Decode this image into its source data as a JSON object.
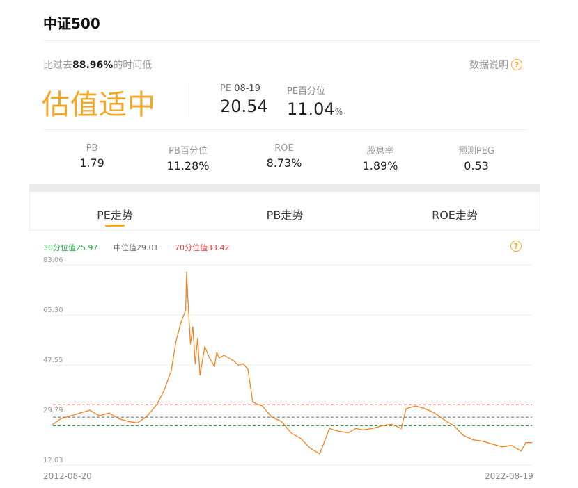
{
  "header": {
    "title": "中证500"
  },
  "summary": {
    "compare_prefix": "比过去",
    "compare_value": "88.96%",
    "compare_suffix": "的时间低",
    "explain_label": "数据说明",
    "help_glyph": "?",
    "status": "估值适中",
    "pe_label": "PE",
    "pe_date": "08-19",
    "pe_value": "20.54",
    "pe_pct_label": "PE百分位",
    "pe_pct_value": "11.04",
    "pe_pct_unit": "%"
  },
  "metrics": [
    {
      "label": "PB",
      "value": "1.79"
    },
    {
      "label": "PB百分位",
      "value": "11.28%"
    },
    {
      "label": "ROE",
      "value": "8.73%"
    },
    {
      "label": "股息率",
      "value": "1.89%"
    },
    {
      "label": "预测PEG",
      "value": "0.53"
    }
  ],
  "tabs": [
    {
      "label": "PE走势",
      "active": true
    },
    {
      "label": "PB走势",
      "active": false
    },
    {
      "label": "ROE走势",
      "active": false
    }
  ],
  "colors": {
    "accent": "#f5a623",
    "line": "#f5821f",
    "p30": "#22aa44",
    "median": "#666666",
    "p70": "#e53935"
  },
  "chart_data": {
    "type": "line",
    "title": "",
    "xlabel": "",
    "ylabel": "",
    "x_start": "2012-08-20",
    "x_end": "2022-08-19",
    "ylim": [
      12.03,
      83.06
    ],
    "yticks": [
      "83.06",
      "65.30",
      "47.55",
      "29.79",
      "12.03"
    ],
    "legend": {
      "p30_label": "30分位值25.97",
      "median_label": "中位值29.01",
      "p70_label": "70分位值33.42"
    },
    "reference_lines": {
      "p30": 25.97,
      "median": 29.01,
      "p70": 33.42
    },
    "x": [
      2012.63,
      2012.8,
      2013.0,
      2013.2,
      2013.4,
      2013.6,
      2013.8,
      2014.0,
      2014.2,
      2014.4,
      2014.6,
      2014.8,
      2014.95,
      2015.1,
      2015.2,
      2015.3,
      2015.4,
      2015.42,
      2015.45,
      2015.5,
      2015.55,
      2015.6,
      2015.65,
      2015.7,
      2015.8,
      2015.9,
      2016.0,
      2016.05,
      2016.1,
      2016.2,
      2016.3,
      2016.4,
      2016.5,
      2016.6,
      2016.7,
      2016.8,
      2016.9,
      2017.0,
      2017.2,
      2017.4,
      2017.6,
      2017.8,
      2018.0,
      2018.2,
      2018.4,
      2018.6,
      2018.8,
      2018.95,
      2019.1,
      2019.3,
      2019.5,
      2019.7,
      2019.9,
      2020.0,
      2020.2,
      2020.4,
      2020.6,
      2020.8,
      2021.0,
      2021.2,
      2021.4,
      2021.6,
      2021.8,
      2022.0,
      2022.2,
      2022.4,
      2022.5,
      2022.63
    ],
    "values": [
      26.5,
      28.5,
      29.5,
      30.5,
      31.5,
      29.5,
      30.5,
      28.5,
      27.5,
      27.0,
      29.5,
      33.5,
      38.5,
      45.5,
      56.0,
      62.5,
      67.0,
      80.5,
      70.0,
      55.0,
      61.0,
      48.0,
      57.0,
      44.0,
      54.0,
      50.0,
      47.0,
      52.0,
      50.0,
      51.0,
      50.0,
      49.0,
      47.5,
      48.0,
      46.0,
      34.5,
      33.5,
      33.0,
      29.0,
      27.5,
      23.5,
      21.5,
      18.0,
      16.0,
      25.0,
      24.0,
      23.5,
      25.0,
      24.5,
      25.0,
      26.0,
      26.5,
      25.0,
      32.0,
      33.0,
      32.0,
      30.5,
      28.0,
      26.0,
      22.5,
      21.0,
      20.5,
      19.5,
      18.5,
      19.0,
      17.0,
      20.0,
      20.0
    ]
  }
}
